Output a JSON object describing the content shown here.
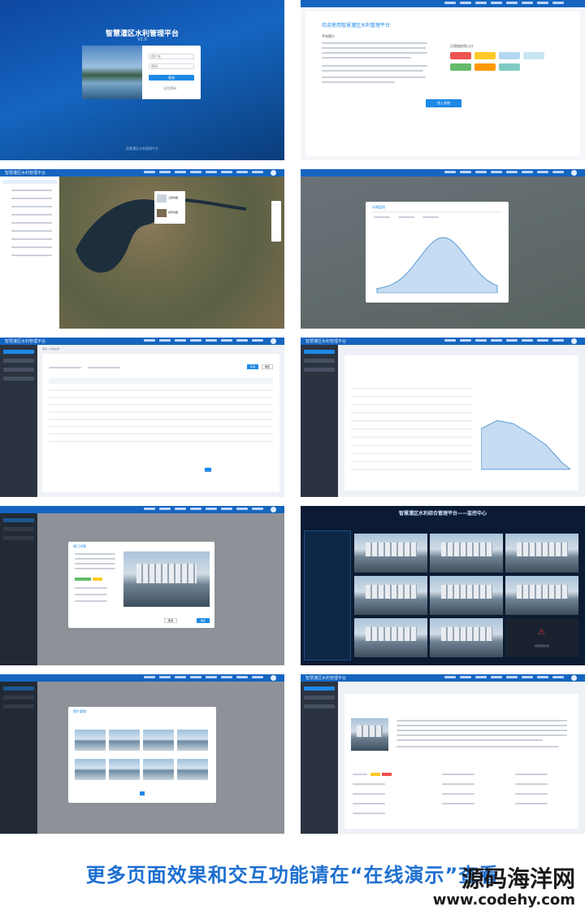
{
  "login": {
    "title": "智慧灌区水利管理平台",
    "version": "V1.0",
    "username_placeholder": "用户名",
    "password_placeholder": "密码",
    "login_button": "登录",
    "remember": "记住密码",
    "copyright": "智慧灌区水利管理平台"
  },
  "welcome": {
    "title": "欢迎使用智慧灌区水利管理平台",
    "section_intro": "平台简介",
    "section_quick": "已添加应用入口",
    "enter_button": "进入系统"
  },
  "app": {
    "header_title": "智慧灌区水利管理平台",
    "user_name": "管理员",
    "account": "admin"
  },
  "map": {
    "popup_labels": [
      "卫星地图",
      "地形地图"
    ]
  },
  "chart_modal": {
    "title": "水情监测",
    "chart": {
      "type": "area",
      "color": "#5b9bd5"
    }
  },
  "table_page": {
    "breadcrumb": "首页 / 水情监测",
    "search_button": "查询",
    "reset_button": "重置"
  },
  "detail_modal": {
    "title": "闸门详情",
    "cancel": "取消",
    "confirm": "确定"
  },
  "monitor": {
    "title": "智慧灌区水利综合管理平台——监控中心",
    "offline_text": "视频加载失败"
  },
  "gallery_modal": {
    "title": "图片管理"
  },
  "footer": {
    "text": "更多页面效果和交互功能请在“在线演示”查看"
  },
  "watermark": {
    "name": "源码海洋网",
    "url": "www.codehy.com"
  },
  "colors": {
    "primary": "#1565c0",
    "accent": "#1e88e5",
    "sidebar": "#2b3340",
    "monitor_bg": "#0b1b33",
    "footer_text": "#1e6fd0"
  }
}
